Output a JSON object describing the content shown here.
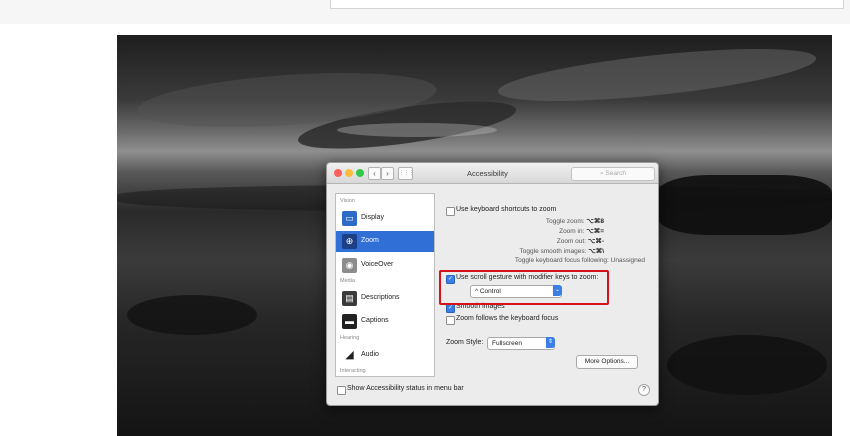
{
  "window": {
    "title": "Accessibility",
    "search_placeholder": "Search",
    "nav_back": "‹",
    "nav_forward": "›",
    "grid_icon": "⋮⋮⋮"
  },
  "sidebar": {
    "categories": {
      "vision": "Vision",
      "media": "Media",
      "hearing": "Hearing",
      "interacting": "Interacting"
    },
    "items": [
      {
        "label": "Display",
        "icon": "display-icon"
      },
      {
        "label": "Zoom",
        "icon": "zoom-icon"
      },
      {
        "label": "VoiceOver",
        "icon": "voiceover-icon"
      },
      {
        "label": "Descriptions",
        "icon": "descriptions-icon"
      },
      {
        "label": "Captions",
        "icon": "captions-icon"
      },
      {
        "label": "Audio",
        "icon": "audio-icon"
      }
    ],
    "selected": "Zoom"
  },
  "pane": {
    "keyboard_shortcuts_label": "Use keyboard shortcuts to zoom",
    "shortcuts": [
      {
        "name": "Toggle zoom:",
        "keys": "⌥⌘8"
      },
      {
        "name": "Zoom in:",
        "keys": "⌥⌘="
      },
      {
        "name": "Zoom out:",
        "keys": "⌥⌘-"
      },
      {
        "name": "Toggle smooth images:",
        "keys": "⌥⌘\\"
      },
      {
        "name": "Toggle keyboard focus following:",
        "keys": "Unassigned"
      }
    ],
    "scroll_gesture_label": "Use scroll gesture with modifier keys to zoom:",
    "modifier_value": "^ Control",
    "smooth_images_label": "Smooth images",
    "follow_focus_label": "Zoom follows the keyboard focus",
    "zoom_style_label": "Zoom Style:",
    "zoom_style_value": "Fullscreen",
    "more_options_label": "More Options...",
    "checked": {
      "keyboard_shortcuts": false,
      "scroll_gesture": true,
      "smooth_images": true,
      "follow_focus": false
    }
  },
  "footer": {
    "menu_bar_label": "Show Accessibility status in menu bar",
    "help_label": "?"
  },
  "colors": {
    "accent": "#2f6fd6",
    "highlight_box": "#d6131b",
    "close": "#fc605c",
    "minimize": "#fdbc40",
    "zoom": "#34c84a"
  }
}
